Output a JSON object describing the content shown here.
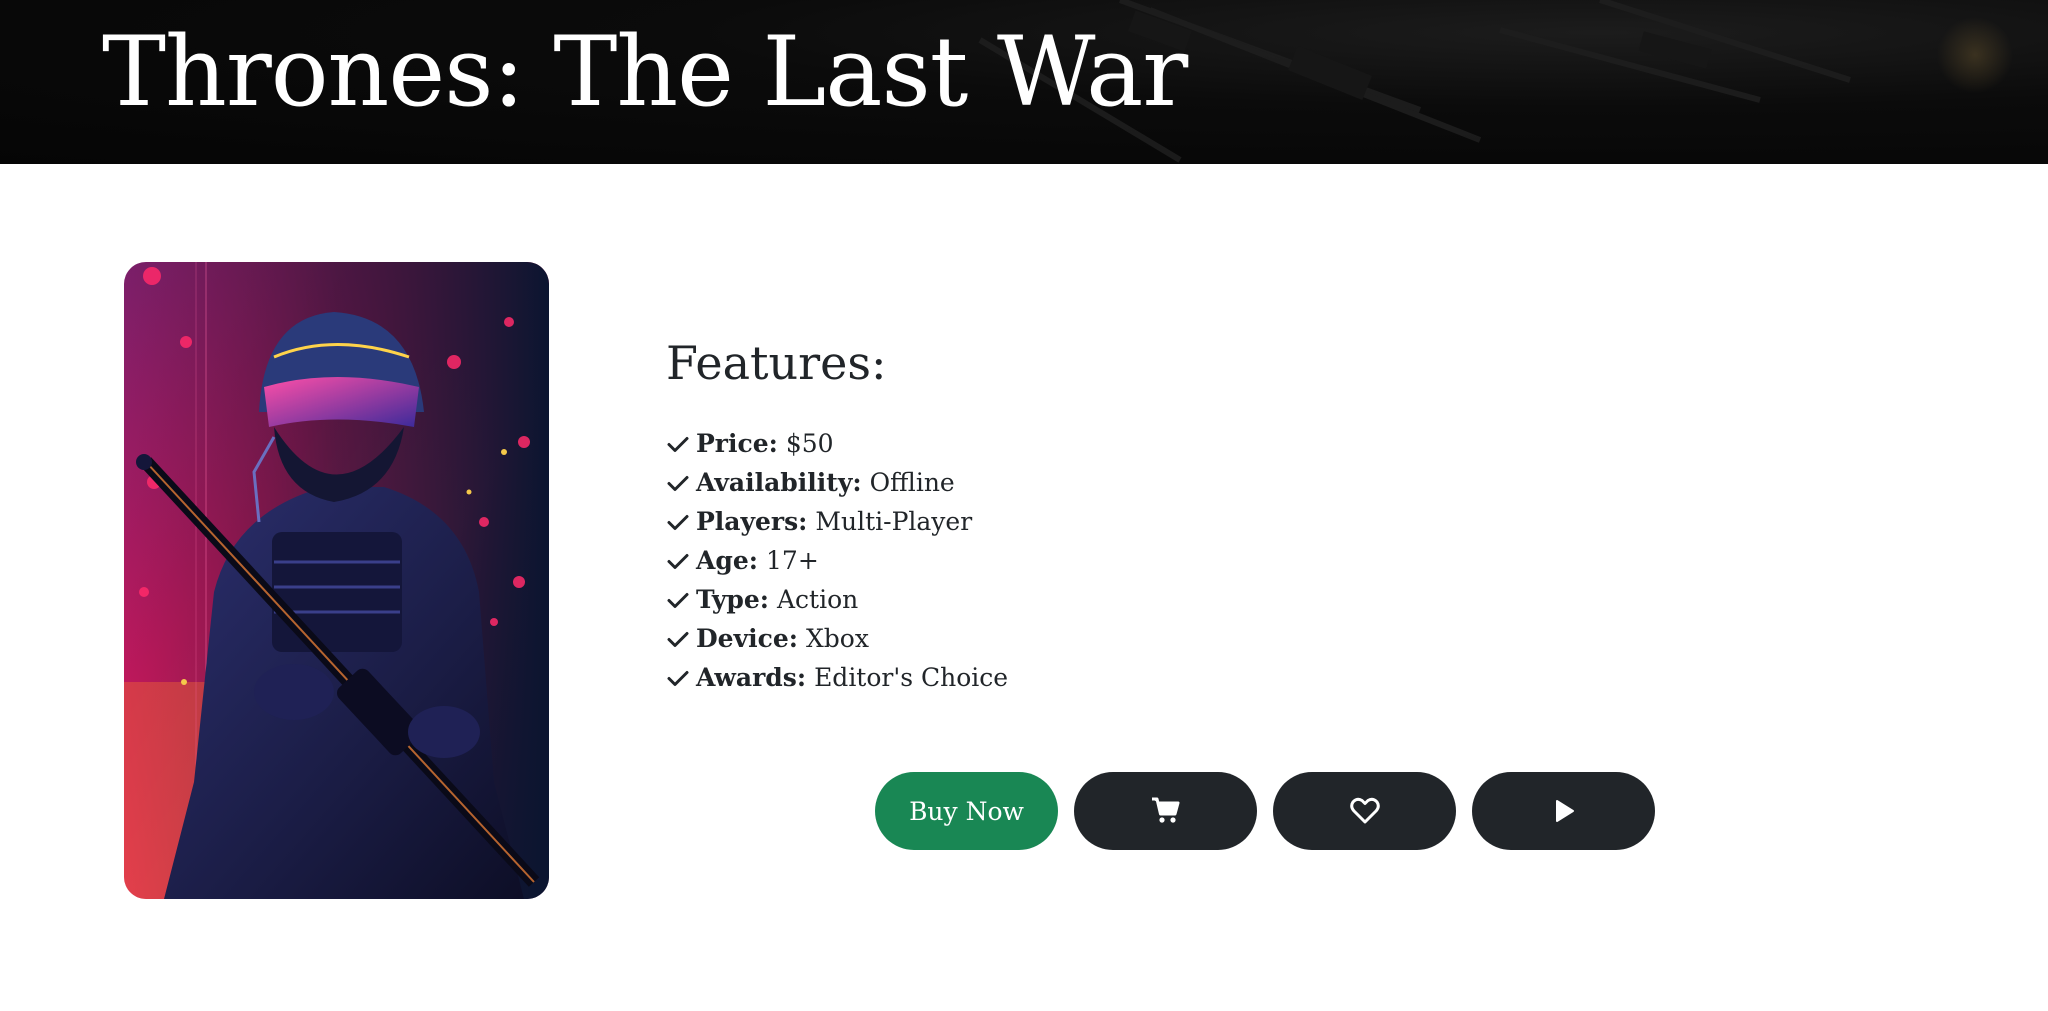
{
  "header": {
    "title": "Thrones: The Last War"
  },
  "cover": {
    "image": "armored-soldier-with-rifle-artwork"
  },
  "features": {
    "heading": "Features:",
    "items": [
      {
        "label": "Price:",
        "value": "$50"
      },
      {
        "label": "Availability:",
        "value": "Offline"
      },
      {
        "label": "Players:",
        "value": "Multi-Player"
      },
      {
        "label": "Age:",
        "value": "17+"
      },
      {
        "label": "Type:",
        "value": "Action"
      },
      {
        "label": "Device:",
        "value": "Xbox"
      },
      {
        "label": "Awards:",
        "value": "Editor's Choice"
      }
    ]
  },
  "actions": {
    "buy_label": "Buy Now",
    "cart_icon": "cart-icon",
    "wishlist_icon": "heart-icon",
    "trailer_icon": "play-icon"
  },
  "colors": {
    "buy_button": "#198754",
    "dark_button": "#212529",
    "header_bg": "#0a0a0a"
  }
}
